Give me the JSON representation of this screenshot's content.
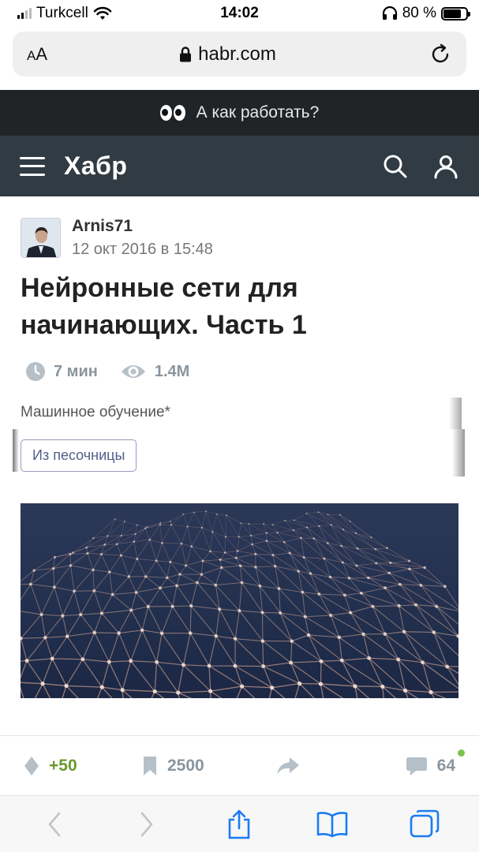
{
  "status_bar": {
    "carrier": "Turkcell",
    "time": "14:02",
    "battery": "80 %",
    "battery_level": 0.8
  },
  "browser": {
    "text_size_label": "AA",
    "url": "habr.com"
  },
  "banner": {
    "text": "А как работать?"
  },
  "header": {
    "logo": "Хабр"
  },
  "article": {
    "author": "Arnis71",
    "date": "12 окт 2016 в 15:48",
    "title": "Нейронные сети для начинающих. Часть 1",
    "read_time": "7 мин",
    "views": "1.4M",
    "hub": "Машинное обучение*",
    "badge": "Из песочницы"
  },
  "actions": {
    "rating": "+50",
    "bookmarks": "2500",
    "comments": "64"
  },
  "colors": {
    "header_bg": "#303b44",
    "banner_bg": "#202427",
    "rating_green": "#6a9a2a",
    "safari_blue": "#1a7cf4",
    "meta_gray": "#8a959e"
  }
}
